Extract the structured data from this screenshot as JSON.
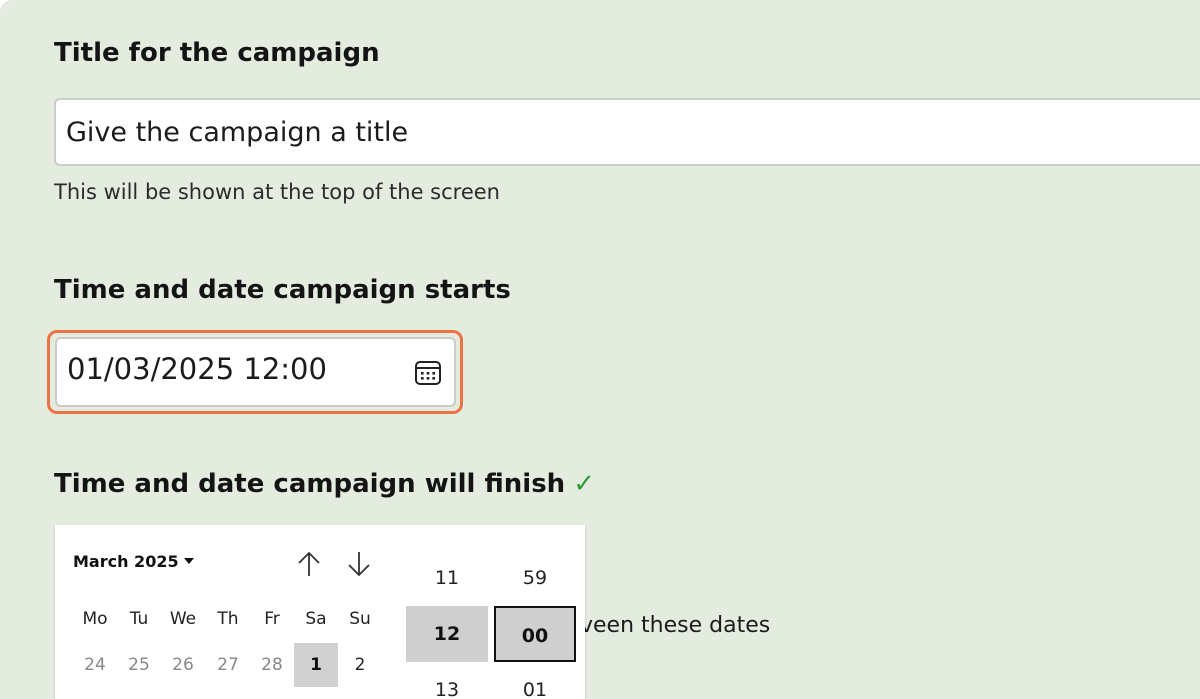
{
  "campaign_title": {
    "label": "Title for the campaign",
    "placeholder": "Give the campaign a title",
    "hint": "This will be shown at the top of the screen"
  },
  "start": {
    "label": "Time and date campaign starts",
    "value": "01/03/2025 12:00",
    "calendar_icon": "calendar-icon",
    "highlight_color": "#ee7246"
  },
  "finish": {
    "label": "Time and date campaign will finish",
    "check_mark": "✓",
    "check_color": "#2e9e3a",
    "partial_text": "veen these dates"
  },
  "picker": {
    "month": "March 2025",
    "prev_icon": "arrow-up-icon",
    "next_icon": "arrow-down-icon",
    "weekdays": [
      "Mo",
      "Tu",
      "We",
      "Th",
      "Fr",
      "Sa",
      "Su"
    ],
    "first_row": [
      "24",
      "25",
      "26",
      "27",
      "28",
      "1",
      "2"
    ],
    "selected_day": "1",
    "hours": [
      "11",
      "12",
      "13"
    ],
    "minutes": [
      "59",
      "00",
      "01"
    ]
  },
  "colors": {
    "background": "#e3ecdf",
    "selected": "#d1d1d1"
  }
}
